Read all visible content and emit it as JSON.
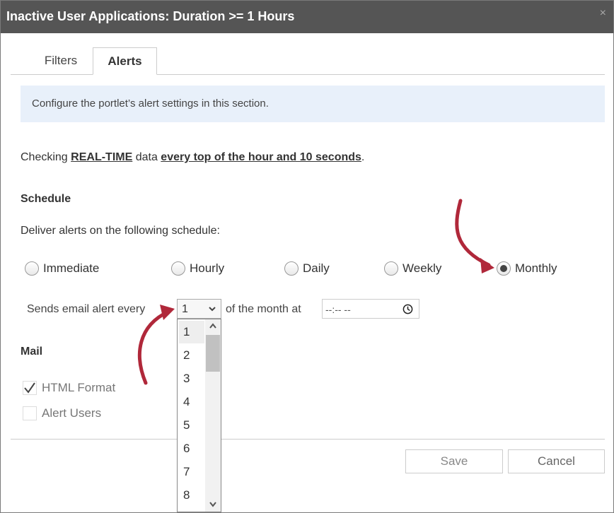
{
  "window": {
    "title": "Inactive User Applications: Duration >= 1 Hours",
    "close_glyph": "×"
  },
  "tabs": [
    {
      "label": "Filters",
      "active": false
    },
    {
      "label": "Alerts",
      "active": true
    }
  ],
  "info_text": "Configure the portlet’s alert settings in this section.",
  "checking": {
    "prefix": "Checking ",
    "source": "REAL-TIME",
    "middle": " data ",
    "frequency": "every top of the hour and 10 seconds",
    "suffix": "."
  },
  "schedule": {
    "heading": "Schedule",
    "deliver_label": "Deliver alerts on the following schedule:",
    "options": [
      {
        "label": "Immediate",
        "selected": false
      },
      {
        "label": "Hourly",
        "selected": false
      },
      {
        "label": "Daily",
        "selected": false
      },
      {
        "label": "Weekly",
        "selected": false
      },
      {
        "label": "Monthly",
        "selected": true
      }
    ],
    "sends_label": "Sends email alert every",
    "day_value": "1",
    "of_month_label": "of the month at",
    "time_value": "--:-- --"
  },
  "day_dropdown": {
    "options": [
      "1",
      "2",
      "3",
      "4",
      "5",
      "6",
      "7",
      "8"
    ],
    "selected": "1"
  },
  "mail": {
    "heading": "Mail",
    "html_format": {
      "label": "HTML Format",
      "checked": true
    },
    "alert_users": {
      "label": "Alert Users",
      "checked": false
    }
  },
  "buttons": {
    "save": "Save",
    "cancel": "Cancel"
  },
  "colors": {
    "titlebar": "#555555",
    "info_bg": "#e8f0fa",
    "annotation_arrow": "#b0283a"
  },
  "icons": {
    "close": "close-icon",
    "select_chevron": "chevron-down-icon",
    "time": "clock-icon",
    "check": "checkmark-icon"
  }
}
